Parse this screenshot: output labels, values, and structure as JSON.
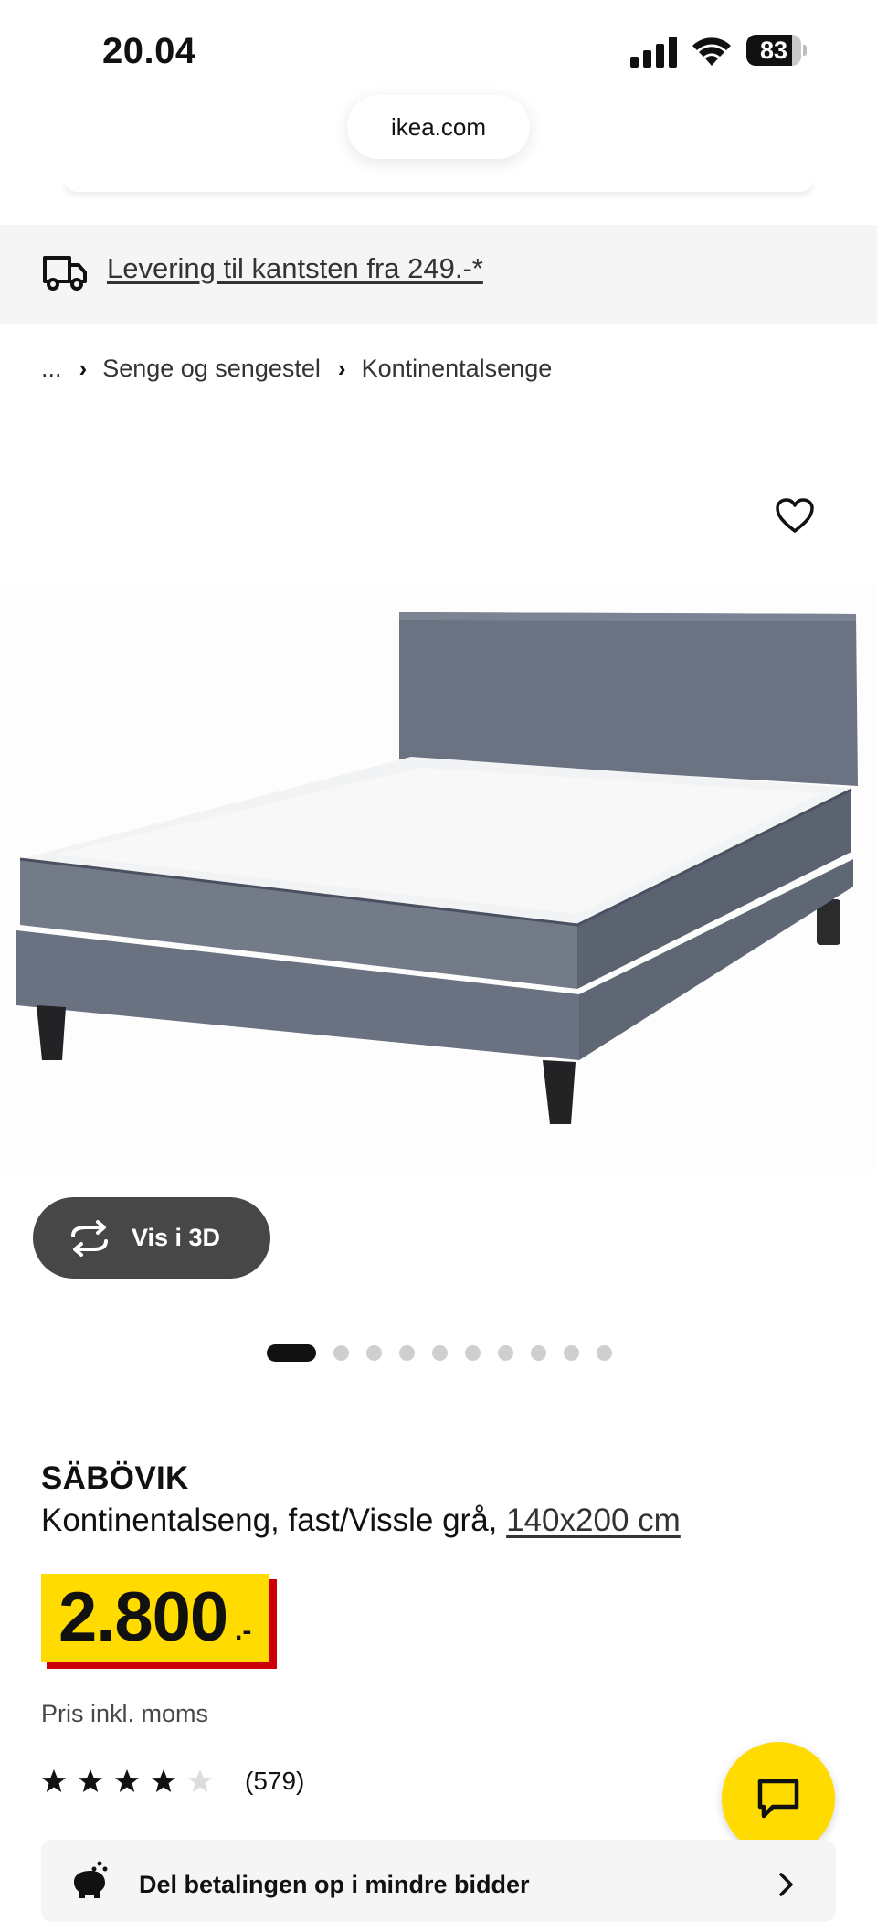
{
  "status_bar": {
    "time": "20.04",
    "battery_level": "83",
    "battery_fraction": 0.83
  },
  "browser": {
    "url": "ikea.com"
  },
  "delivery": {
    "text": "Levering til kantsten fra 249.-*"
  },
  "breadcrumb": {
    "ellipsis": "...",
    "items": [
      "Senge og sengestel",
      "Kontinentalsenge"
    ]
  },
  "gallery": {
    "vis3d_label": "Vis i 3D",
    "total_images": 10,
    "active_index": 0
  },
  "product": {
    "name": "SÄBÖVIK",
    "description": "Kontinentalseng, fast/Vissle grå,",
    "size": "140x200 cm",
    "price": "2.800",
    "price_suffix": ".-",
    "price_note": "Pris inkl. moms",
    "rating": 4,
    "rating_max": 5,
    "review_count": "(579)"
  },
  "installment": {
    "label": "Del betalingen op i mindre bidder"
  },
  "colors": {
    "ikea_yellow": "#ffdb00",
    "ikea_red": "#cc0008",
    "dark_button": "#474747"
  },
  "icons": [
    "signal-icon",
    "wifi-icon",
    "battery-icon",
    "truck-icon",
    "chevron-right-icon",
    "heart-icon",
    "rotate-3d-icon",
    "star-icon",
    "chat-icon",
    "piggy-bank-icon"
  ]
}
